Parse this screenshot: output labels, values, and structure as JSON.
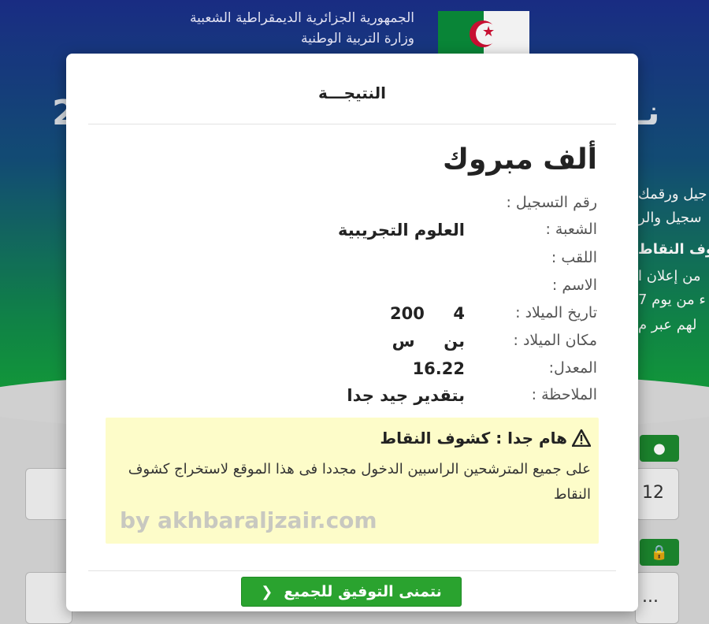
{
  "background": {
    "republic_line1": "الجمهورية الجزائرية الديمقراطية الشعبية",
    "republic_line2": "وزارة التربية الوطنية",
    "side_title": "نـ",
    "left_title": "2",
    "side_lines": [
      "جيل ورقمك",
      "سجيل والر",
      "وف النقاط",
      "من إعلان ا",
      "ء من يوم 7",
      "لهم عبر م"
    ],
    "card_value": "12",
    "card_value_2": "..."
  },
  "modal": {
    "title": "النتيجـــة",
    "congrats": "ألف مبروك",
    "fields": [
      {
        "label": "رقم التسجيل :",
        "value": ""
      },
      {
        "label": "الشعبة :",
        "value": "العلوم التجريبية"
      },
      {
        "label": "اللقب :",
        "value": ""
      },
      {
        "label": "الاسم :",
        "value": ""
      },
      {
        "label": "تاريخ الميلاد :",
        "value": "200     4"
      },
      {
        "label": "مكان الميلاد :",
        "value": "بن     س"
      },
      {
        "label": "المعدل:",
        "value": "16.22"
      },
      {
        "label": "الملاحظة :",
        "value": "بتقدير جيد جدا"
      }
    ],
    "alert": {
      "title": "هام جدا : كشوف النقاط",
      "body": "على جميع المترشحين الراسبين الدخول مجددا فى هذا الموقع لاستخراج كشوف النقاط"
    },
    "watermark": "by akhbaraljzair.com",
    "footer_button": "نتمنى التوفيق للجميع"
  }
}
